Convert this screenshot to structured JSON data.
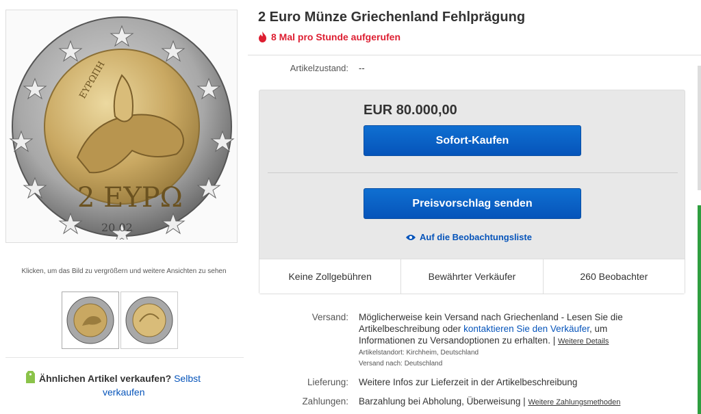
{
  "listing": {
    "title": "2 Euro Münze Griechenland Fehlprägung",
    "views": "8 Mal pro Stunde aufgerufen",
    "condition_label": "Artikelzustand:",
    "condition_value": "--"
  },
  "gallery": {
    "hint": "Klicken, um das Bild zu vergrößern und weitere Ansichten zu sehen",
    "coin_text": "ΕΥΡΩΠΗ",
    "coin_value": "2 ΕΥΡΩ",
    "coin_year": "20 02"
  },
  "buybox": {
    "price": "EUR 80.000,00",
    "buy_now": "Sofort-Kaufen",
    "make_offer": "Preisvorschlag senden",
    "watchlist": "Auf die Beobachtungsliste",
    "badges": [
      "Keine Zollgebühren",
      "Bewährter Verkäufer",
      "260 Beobachter"
    ]
  },
  "details": {
    "shipping_label": "Versand:",
    "shipping_text_1": "Möglicherweise kein Versand nach Griechenland - Lesen Sie die Artikelbeschreibung oder ",
    "shipping_link": "kontaktieren Sie den Verkäufer",
    "shipping_text_2": ", um Informationen zu Versandoptionen zu erhalten. | ",
    "shipping_more": "Weitere Details",
    "location": "Artikelstandort:  Kirchheim, Deutschland",
    "ships_to": "Versand nach:  Deutschland",
    "delivery_label": "Lieferung:",
    "delivery_value": "Weitere Infos zur Lieferzeit in der Artikelbeschreibung",
    "payment_label": "Zahlungen:",
    "payment_value": "Barzahlung bei Abholung,  Überweisung  | ",
    "payment_more": "Weitere Zahlungsmethoden"
  },
  "sell_similar": {
    "question": "Ähnlichen Artikel verkaufen?",
    "link_1": "Selbst",
    "link_2": "verkaufen"
  },
  "colors": {
    "price_blue": "#0654ba",
    "alert_red": "#dd1e31",
    "gold": "#c9a862",
    "silver": "#9a9a9a"
  }
}
